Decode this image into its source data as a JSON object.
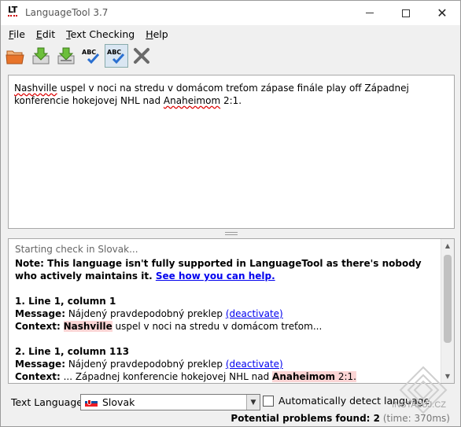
{
  "window": {
    "title": "LanguageTool 3.7",
    "logo_text": "LT",
    "controls": {
      "minimize": "minimize",
      "maximize": "maximize",
      "close": "close"
    }
  },
  "menu": [
    {
      "mnemonic": "F",
      "rest": "ile"
    },
    {
      "mnemonic": "E",
      "rest": "dit"
    },
    {
      "mnemonic": "T",
      "rest": "ext Checking"
    },
    {
      "mnemonic": "H",
      "rest": "elp"
    }
  ],
  "toolbar": {
    "icons": [
      "open-folder-icon",
      "save-icon",
      "save-as-icon",
      "check-text-icon",
      "auto-check-icon",
      "close-icon"
    ],
    "abc_label": "ABC"
  },
  "editor": {
    "err1": "Nashville",
    "seg1": " uspel v noci na stredu v domácom treťom zápase finále play off Západnej konferencie hokejovej NHL nad ",
    "err2": "Anaheimom",
    "seg2": " 2:1."
  },
  "results": {
    "status": "Starting check in Slovak...",
    "note_label": "Note:",
    "note_text": " This language isn't fully supported in LanguageTool as there's nobody who actively maintains it. ",
    "note_link": "See how you can help.",
    "issues": [
      {
        "heading": "1. Line 1, column 1",
        "message_label": "Message:",
        "message_text": " Nájdený pravdepodobný preklep ",
        "deactivate": "(deactivate)",
        "context_label": "Context:",
        "context_pre": " ",
        "context_hl": "Nashville",
        "context_post": " uspel v noci na stredu v domácom treťom..."
      },
      {
        "heading": "2. Line 1, column 113",
        "message_label": "Message:",
        "message_text": " Nájdený pravdepodobný preklep ",
        "deactivate": "(deactivate)",
        "context_label": "Context:",
        "context_pre": " ... Západnej konferencie hokejovej NHL nad ",
        "context_hl": "Anaheimom",
        "context_post": " 2:1."
      }
    ]
  },
  "footer": {
    "language_label": "Text Language:",
    "language_value": "Slovak",
    "auto_detect_label": "Automatically detect language",
    "auto_detect_checked": false,
    "problems_label": "Potential problems found: 2",
    "time_text": " (time: 370ms)"
  },
  "watermark": "INSTALUJ.CZ",
  "colors": {
    "error_underline": "#d00000",
    "highlight": "#fbd5d5",
    "link": "#0000ee"
  }
}
